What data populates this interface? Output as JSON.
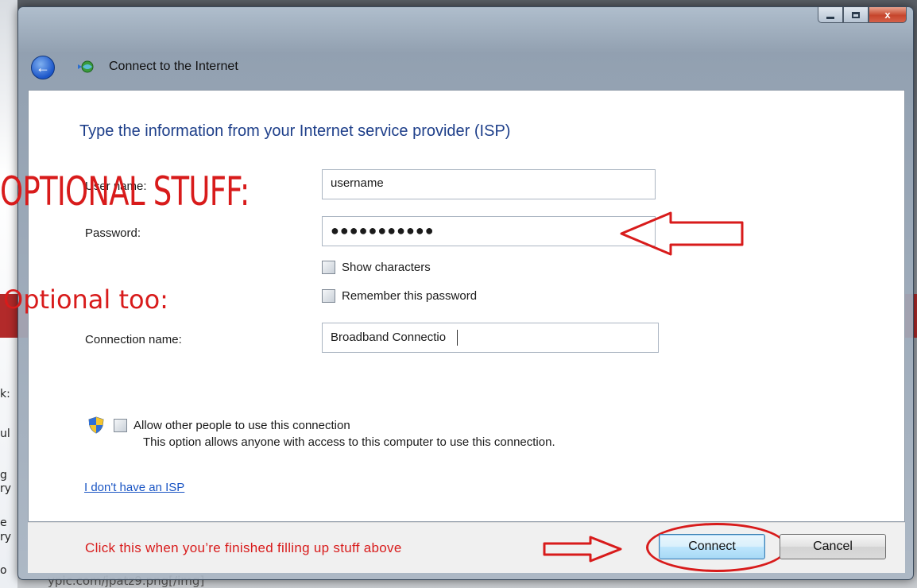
{
  "background": {
    "side_fragments": [
      "k:",
      "ul",
      "g",
      "ry",
      "e",
      "ry",
      "o"
    ],
    "bottom_text": "ypic.com/jpatz9.png[/img]"
  },
  "window": {
    "title": "Connect to the Internet",
    "caption_buttons": {
      "minimize": "minimize",
      "maximize": "maximize",
      "close": "x"
    }
  },
  "page": {
    "heading": "Type the information from your Internet service provider (ISP)",
    "username_label": "User name:",
    "username_value": "username",
    "password_label": "Password:",
    "password_value": "●●●●●●●●●●●",
    "show_characters": "Show characters",
    "remember_password": "Remember this password",
    "connection_name_label": "Connection name:",
    "connection_name_value": "Broadband Connectio",
    "allow_others": "Allow other people to use this connection",
    "allow_others_note": "This option allows anyone with access to this computer to use  this connection.",
    "no_isp_link": "I don't have an ISP"
  },
  "annotations": {
    "optional_big": "OPTIONAL STUFF:",
    "optional_too": "Optional too:",
    "footer_note": "Click this when you’re finished filling up stuff above",
    "color": "#d81b1b"
  },
  "footer": {
    "connect_label": "Connect",
    "cancel_label": "Cancel"
  }
}
